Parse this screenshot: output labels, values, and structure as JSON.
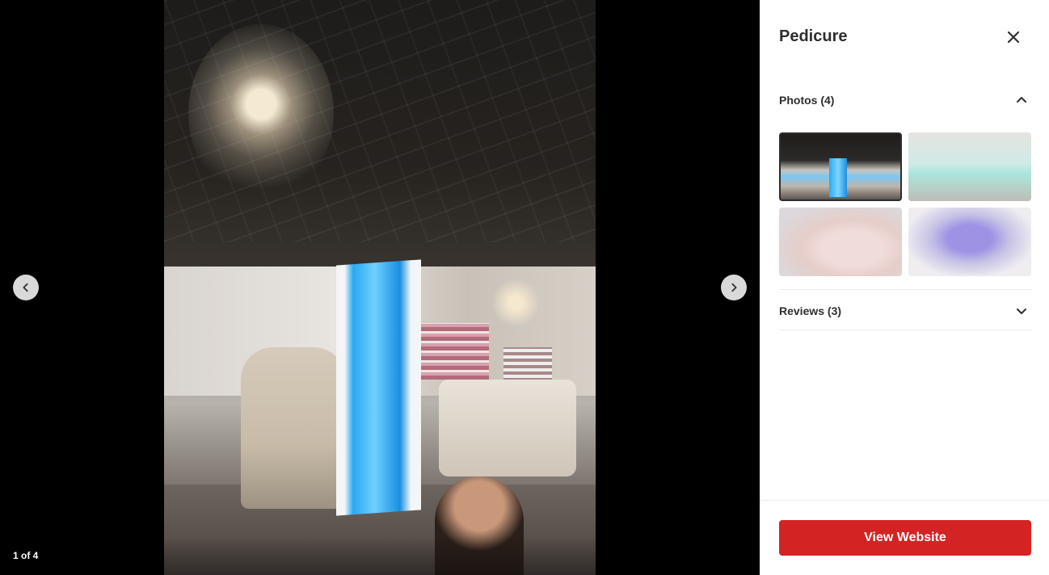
{
  "viewer": {
    "counter": "1 of 4",
    "prev_icon": "chevron-left-icon",
    "next_icon": "chevron-right-icon"
  },
  "sidebar": {
    "title": "Pedicure",
    "close_icon": "close-icon",
    "photos_section": {
      "label": "Photos (4)",
      "icon": "chevron-up-icon",
      "expanded": true
    },
    "thumbnails": [
      {
        "name": "thumbnail-1",
        "selected": true
      },
      {
        "name": "thumbnail-2",
        "selected": false
      },
      {
        "name": "thumbnail-3",
        "selected": false
      },
      {
        "name": "thumbnail-4",
        "selected": false
      }
    ],
    "reviews_section": {
      "label": "Reviews (3)",
      "icon": "chevron-down-icon",
      "expanded": false
    },
    "cta_label": "View Website"
  },
  "colors": {
    "cta_background": "#d32323",
    "text_primary": "#2d2e2f",
    "divider": "#ebebeb",
    "viewer_background": "#000000"
  }
}
